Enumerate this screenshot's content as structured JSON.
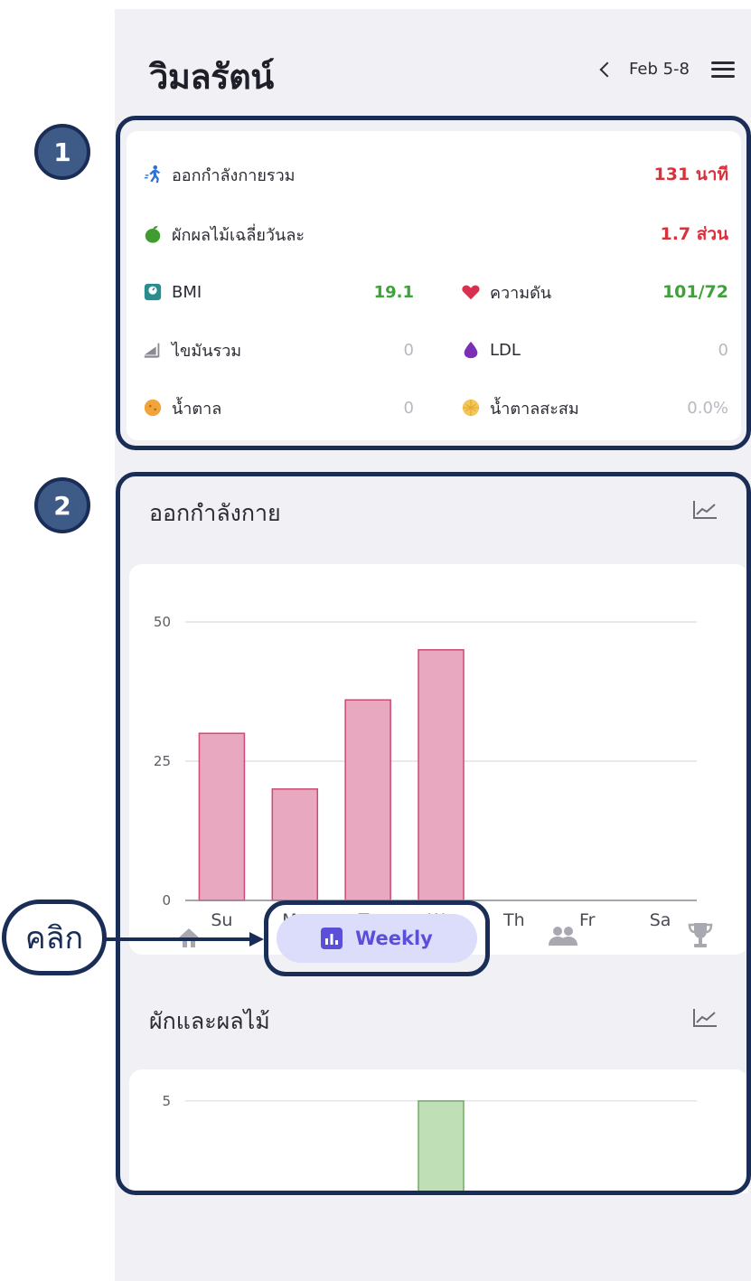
{
  "header": {
    "title": "วิมลรัตน์",
    "date_range": "Feb 5-8"
  },
  "summary": {
    "exercise_total": {
      "label": "ออกกำลังกายรวม",
      "value": "131 นาที"
    },
    "fruit_veg_avg": {
      "label": "ผักผลไม้เฉลี่ยวันละ",
      "value": "1.7 ส่วน"
    },
    "bmi": {
      "label": "BMI",
      "value": "19.1"
    },
    "blood_pressure": {
      "label": "ความดัน",
      "value": "101/72"
    },
    "total_fat": {
      "label": "ไขมันรวม",
      "value": "0"
    },
    "ldl": {
      "label": "LDL",
      "value": "0"
    },
    "sugar": {
      "label": "น้ำตาล",
      "value": "0"
    },
    "hba1c": {
      "label": "น้ำตาลสะสม",
      "value": "0.0%"
    }
  },
  "exercise_section": {
    "title": "ออกกำลังกาย"
  },
  "veg_section": {
    "title": "ผักและผลไม้"
  },
  "chart_data": [
    {
      "type": "bar",
      "categories": [
        "Su",
        "Mo",
        "Tu",
        "We",
        "Th",
        "Fr",
        "Sa"
      ],
      "values": [
        30,
        20,
        36,
        45,
        0,
        0,
        0
      ],
      "y_ticks": [
        "0",
        "25",
        "50"
      ],
      "ylim": [
        0,
        50
      ],
      "grid": true,
      "color": "#e8a8c0"
    },
    {
      "type": "bar",
      "categories": [
        "Su",
        "Mo",
        "Tu",
        "We",
        "Th",
        "Fr",
        "Sa"
      ],
      "values": [
        0,
        0,
        0,
        5,
        0,
        0,
        0
      ],
      "y_ticks": [
        "5"
      ],
      "ylim": [
        0,
        6
      ],
      "grid": true,
      "color": "#bfe0b7"
    }
  ],
  "bottom_nav": {
    "home_icon": "home-icon",
    "weekly_label": "Weekly",
    "friends_icon": "people-icon",
    "trophy_icon": "trophy-icon"
  },
  "annotations": {
    "marker_1": "1",
    "marker_2": "2",
    "click_label": "คลิก"
  },
  "colors": {
    "red_value": "#d8323c",
    "green_value": "#3fa13a",
    "grey_value": "#b8b8c0",
    "outline": "#1a2d57",
    "marker_fill": "#3e5a87",
    "nav_pill": "#dcdcfb",
    "nav_accent": "#5b4fd8"
  }
}
